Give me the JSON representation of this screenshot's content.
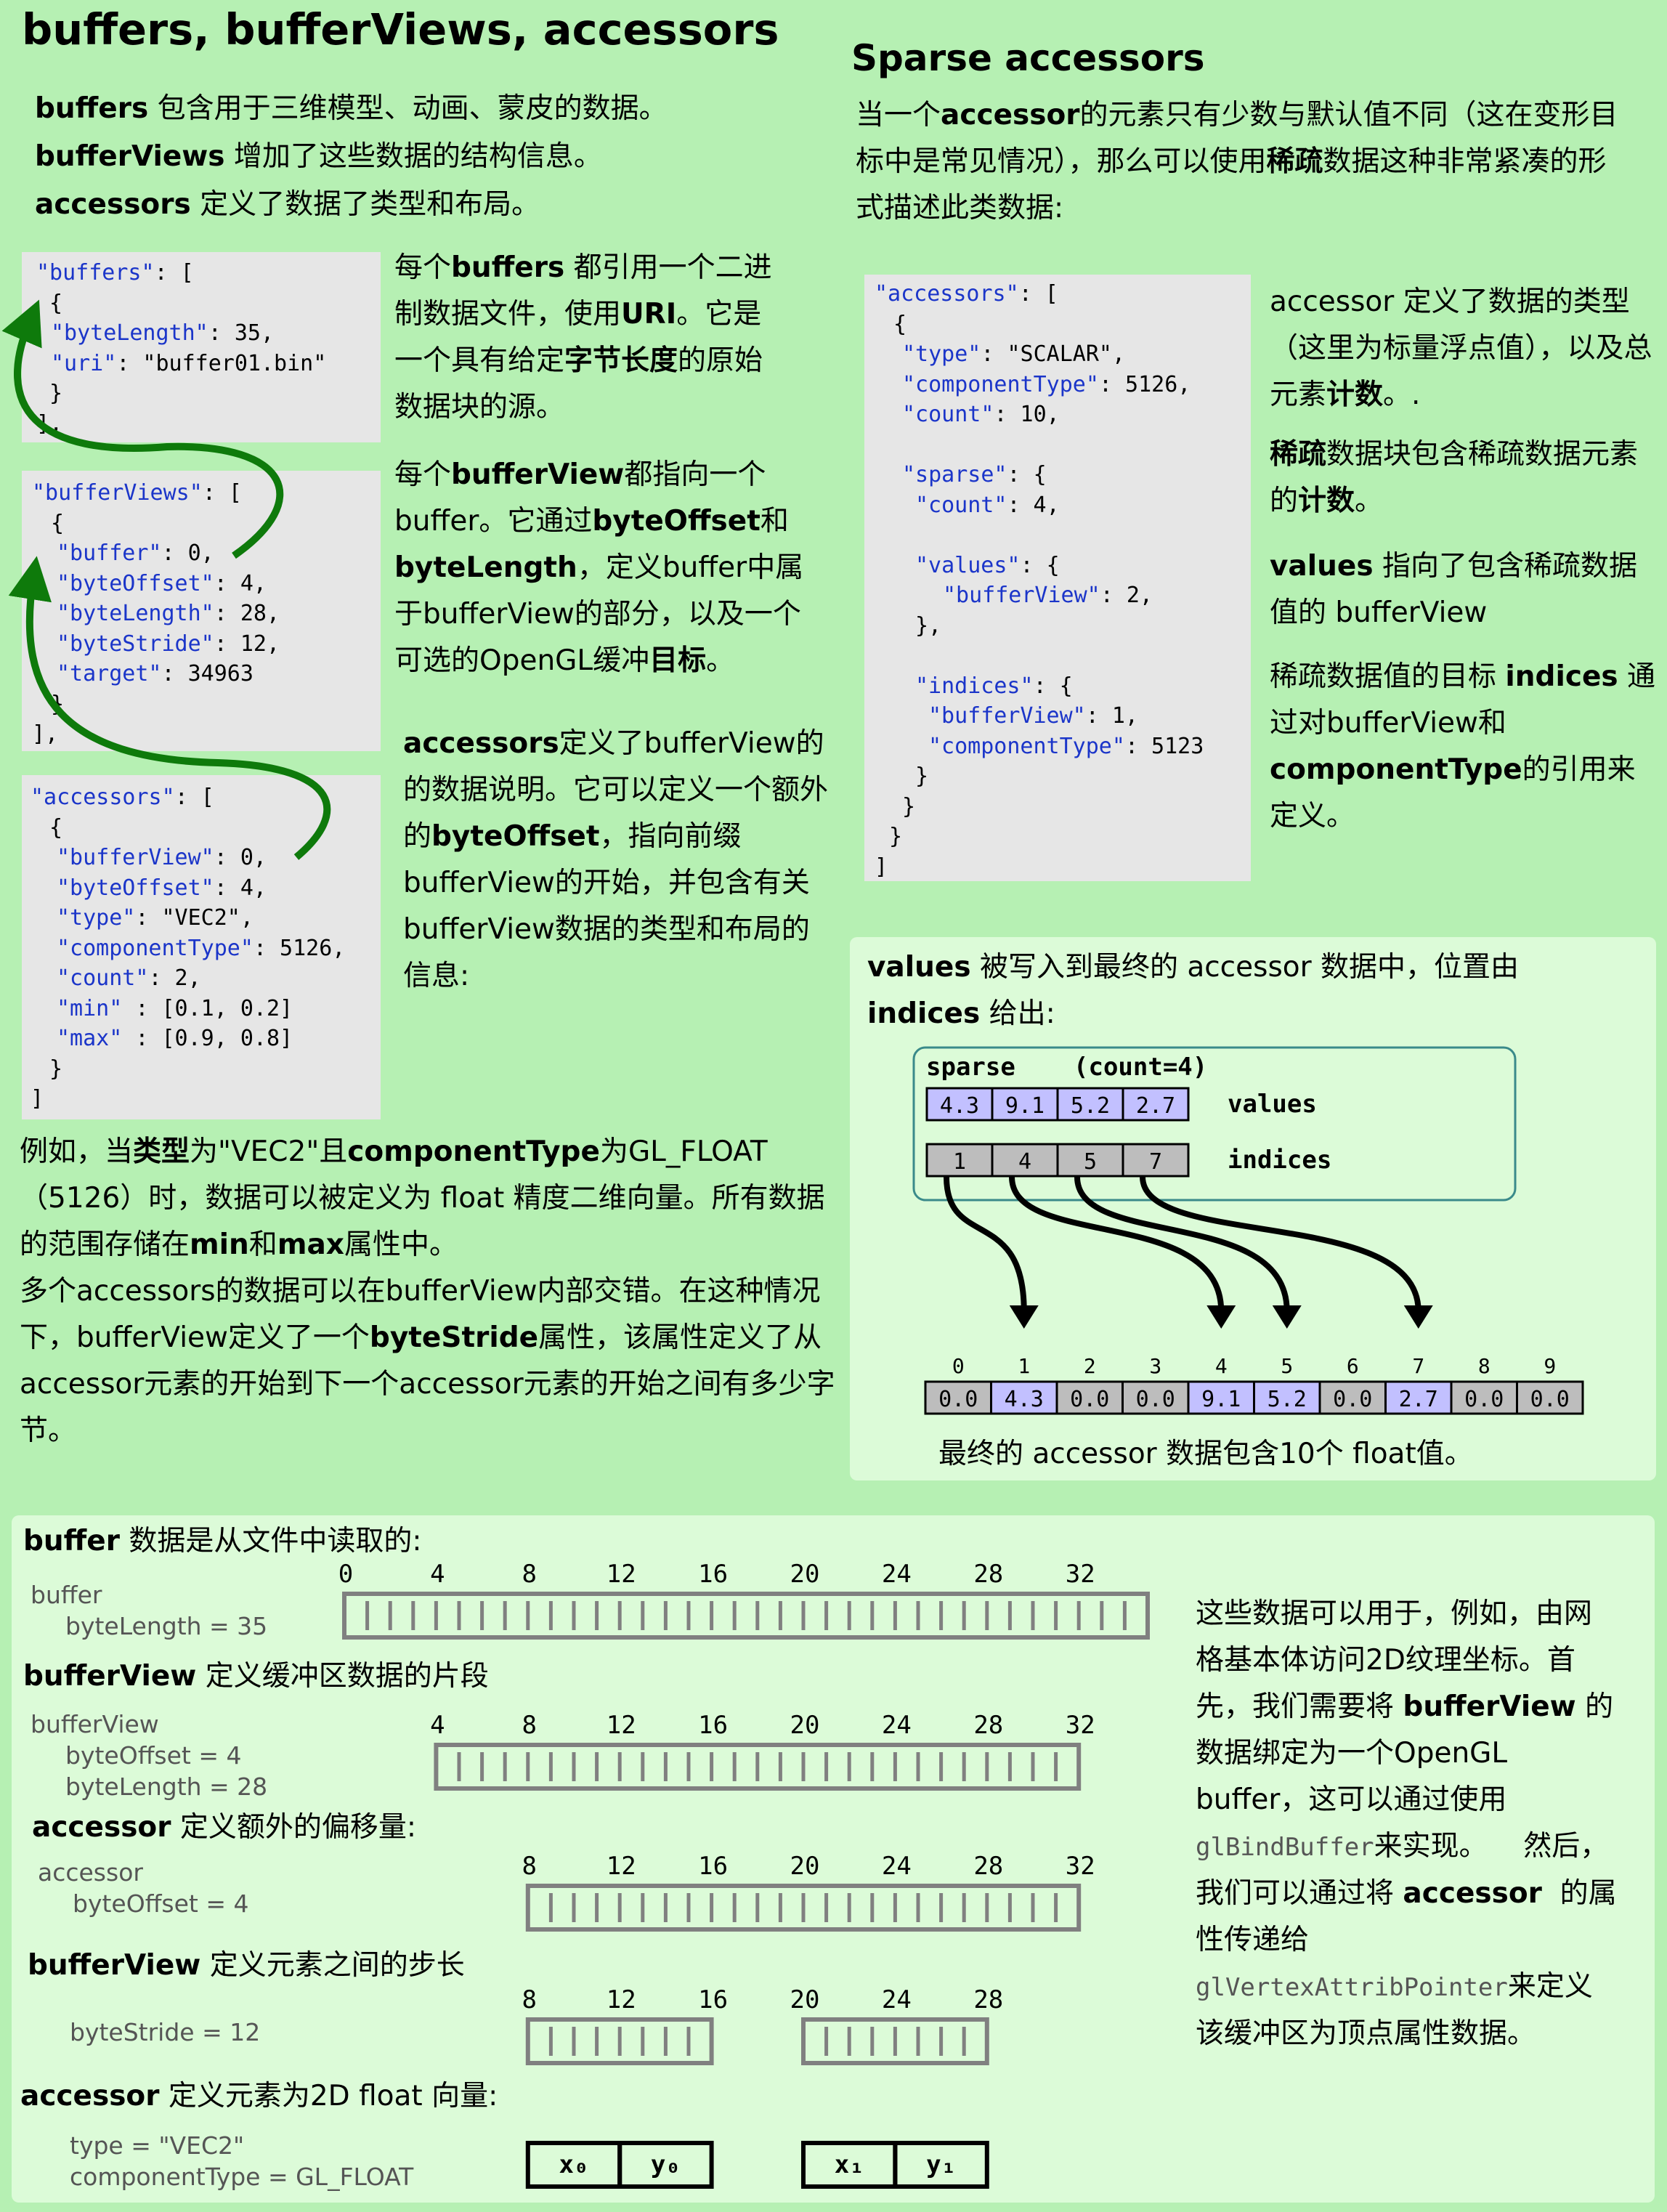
{
  "title": "buffers, bufferViews, accessors",
  "intro": [
    {
      "b": "buffers",
      "t": " 包含用于三维模型、动画、蒙皮的数据。"
    },
    {
      "b": "bufferViews",
      "t": " 增加了这些数据的结构信息。"
    },
    {
      "b": "accessors",
      "t": " 定义了数据了类型和布局。"
    }
  ],
  "code_buffers": {
    "l1_key": "\"buffers\"",
    "l1_rest": ": [",
    "l2": " {",
    "l3_key": "\"byteLength\"",
    "l3_rest": ": 35,",
    "l4_key": "\"uri\"",
    "l4_rest": ": \"buffer01.bin\"",
    "l5": " }",
    "l6": "],"
  },
  "desc_buffers": {
    "a": "每个",
    "b1": "buffers",
    "c": " 都引用一个二进制数据文件，使用",
    "b2": "URI",
    "d": "。它是一个具有给定",
    "b3": "字节长度",
    "e": "的原始数据块的源。"
  },
  "code_bufferviews": {
    "l1_key": "\"bufferViews\"",
    "l1_rest": ": [",
    "l2": " {",
    "l3_key": "\"buffer\"",
    "l3_rest": ": 0,",
    "l4_key": "\"byteOffset\"",
    "l4_rest": ": 4,",
    "l5_key": "\"byteLength\"",
    "l5_rest": ": 28,",
    "l6_key": "\"byteStride\"",
    "l6_rest": ": 12,",
    "l7_key": "\"target\"",
    "l7_rest": ": 34963",
    "l8": " }",
    "l9": "],"
  },
  "desc_bufferviews": {
    "a": "每个",
    "b1": "bufferView",
    "c": "都指向一个buffer。它通过",
    "b2": "byteOffset",
    "d": "和",
    "b3": "byteLength",
    "e": "，定义buffer中属于bufferView的部分，以及一个可选的OpenGL缓冲",
    "b4": "目标",
    "f": "。"
  },
  "code_accessors": {
    "l1_key": "\"accessors\"",
    "l1_rest": ": [",
    "l2": " {",
    "l3_key": "\"bufferView\"",
    "l3_rest": ": 0,",
    "l4_key": "\"byteOffset\"",
    "l4_rest": ": 4,",
    "l5_key": "\"type\"",
    "l5_rest": ": \"VEC2\",",
    "l6_key": "\"componentType\"",
    "l6_rest": ": 5126,",
    "l7_key": "\"count\"",
    "l7_rest": ": 2,",
    "l8_key": "\"min\"",
    "l8_rest": " : [0.1, 0.2]",
    "l9_key": "\"max\"",
    "l9_rest": " : [0.9, 0.8]",
    "l10": " }",
    "l11": "]"
  },
  "desc_accessors": {
    "b1": "accessors",
    "a": "定义了bufferView的的数据说明。它可以定义一个额外的",
    "b2": "byteOffset",
    "c": "，指向前缀bufferView的开始，并包含有关bufferView数据的类型和布局的信息:"
  },
  "example": {
    "a": "例如，当",
    "b1": "类型",
    "c": "为\"VEC2\"且",
    "b2": "componentType",
    "d": "为GL_FLOAT（5126）时，数据可以被定义为 float 精度二维向量。所有数据的范围存储在",
    "b3": "min",
    "e": "和",
    "b4": "max",
    "f": "属性中。",
    "g": "多个accessors的数据可以在bufferView内部交错。在这种情况下，bufferView定义了一个",
    "b5": "byteStride",
    "h": "属性，该属性定义了从accessor元素的开始到下一个accessor元素的开始之间有多少字节。"
  },
  "sparse_title": "Sparse accessors",
  "sparse_intro": {
    "a": "当一个",
    "b1": "accessor",
    "c": "的元素只有少数与默认值不同（这在变形目标中是常见情况），那么可以使用",
    "b2": "稀疏",
    "d": "数据这种非常紧凑的形式描述此类数据:"
  },
  "code_sparse": {
    "l1_key": "\"accessors\"",
    "l1_rest": ": [",
    "l2": " {",
    "l3_key": "\"type\"",
    "l3_rest": ": \"SCALAR\",",
    "l4_key": "\"componentType\"",
    "l4_rest": ": 5126,",
    "l5_key": "\"count\"",
    "l5_rest": ": 10,",
    "l6_key": "\"sparse\"",
    "l6_rest": ": {",
    "l7_key": "\"count\"",
    "l7_rest": ": 4,",
    "l8_key": "\"values\"",
    "l8_rest": ": {",
    "l9_key": "\"bufferView\"",
    "l9_rest": ": 2,",
    "l10": "},",
    "l11_key": "\"indices\"",
    "l11_rest": ": {",
    "l12_key": "\"bufferView\"",
    "l12_rest": ": 1,",
    "l13_key": "\"componentType\"",
    "l13_rest": ": 5123",
    "l14": "}",
    "l15": "}",
    "l16": "}",
    "l17": "]"
  },
  "sparse_desc": {
    "p1a": "accessor 定义了数据的类型（这里为标量浮点值），以及总元素",
    "p1b": "计数",
    "p1c": "。.",
    "p2b1": "稀疏",
    "p2a": "数据块包含稀疏数据元素的",
    "p2b2": "计数",
    "p2c": "。",
    "p3b": "values",
    "p3a": " 指向了包含稀疏数据值的 bufferView",
    "p4a": "稀疏数据值的目标 ",
    "p4b1": "indices",
    "p4c": " 通过对bufferView和",
    "p4b2": "componentType",
    "p4d": "的引用来定义。"
  },
  "sparse_diagram": {
    "intro_b1": "values",
    "intro_a": " 被写入到最终的 accessor 数据中，位置由 ",
    "intro_b2": "indices",
    "intro_c": " 给出:",
    "sparse_label": "sparse",
    "count_label": "(count=4)",
    "values": [
      "4.3",
      "9.1",
      "5.2",
      "2.7"
    ],
    "values_label": "values",
    "indices": [
      "1",
      "4",
      "5",
      "7"
    ],
    "indices_label": "indices",
    "final_indices": [
      "0",
      "1",
      "2",
      "3",
      "4",
      "5",
      "6",
      "7",
      "8",
      "9"
    ],
    "final_values": [
      "0.0",
      "4.3",
      "0.0",
      "0.0",
      "9.1",
      "5.2",
      "0.0",
      "2.7",
      "0.0",
      "0.0"
    ],
    "caption": "最终的 accessor 数据包含10个 float值。"
  },
  "bottom": {
    "buffer_heading_b": "buffer",
    "buffer_heading_t": " 数据是从文件中读取的:",
    "buffer_label": "buffer",
    "buffer_prop": "byteLength = 35",
    "buffer_ticks": [
      "0",
      "4",
      "8",
      "12",
      "16",
      "20",
      "24",
      "28",
      "32"
    ],
    "bv_heading_b": "bufferView",
    "bv_heading_t": " 定义缓冲区数据的片段",
    "bv_label": "bufferView",
    "bv_prop1": "byteOffset = 4",
    "bv_prop2": "byteLength = 28",
    "bv_ticks": [
      "4",
      "8",
      "12",
      "16",
      "20",
      "24",
      "28",
      "32"
    ],
    "acc_heading_b": "accessor",
    "acc_heading_t": " 定义额外的偏移量:",
    "acc_label": "accessor",
    "acc_prop": "byteOffset = 4",
    "acc_ticks": [
      "8",
      "12",
      "16",
      "20",
      "24",
      "28",
      "32"
    ],
    "stride_heading_b": "bufferView",
    "stride_heading_t": " 定义元素之间的步长",
    "stride_prop": "byteStride = 12",
    "stride_ticks": [
      "8",
      "12",
      "16",
      "20",
      "24",
      "28"
    ],
    "vec_heading_b": "accessor",
    "vec_heading_t": " 定义元素为2D float 向量:",
    "vec_prop1": "type = \"VEC2\"",
    "vec_prop2": "componentType = GL_FLOAT",
    "vec_labels": [
      "x₀",
      "y₀",
      "x₁",
      "y₁"
    ],
    "side_a": "这些数据可以用于，例如，由网格基本体访问2D纹理坐标。首先，我们需要将 ",
    "side_b1": "bufferView",
    "side_c": " 的数据绑定为一个OpenGL buffer，这可以通过使用",
    "side_m1": "glBindBuffer",
    "side_d": "来实现。    然后，我们可以通过将 ",
    "side_b2": "accessor",
    "side_e": "  的属性传递给 ",
    "side_m2": "glVertexAttribPointer",
    "side_f": "来定义该缓冲区为顶点属性数据。"
  },
  "colors": {
    "background": "#b6f0b3",
    "panel": "#dcfbd8",
    "code_bg": "#e6e6e6",
    "json_key": "#1b35c9",
    "arrow_green": "#0e7a0b",
    "highlight_cell": "#c2c0ff",
    "gray_cell": "#bdbdbd",
    "grid_gray": "#808080",
    "sparse_box_border": "#3a8a8a"
  }
}
